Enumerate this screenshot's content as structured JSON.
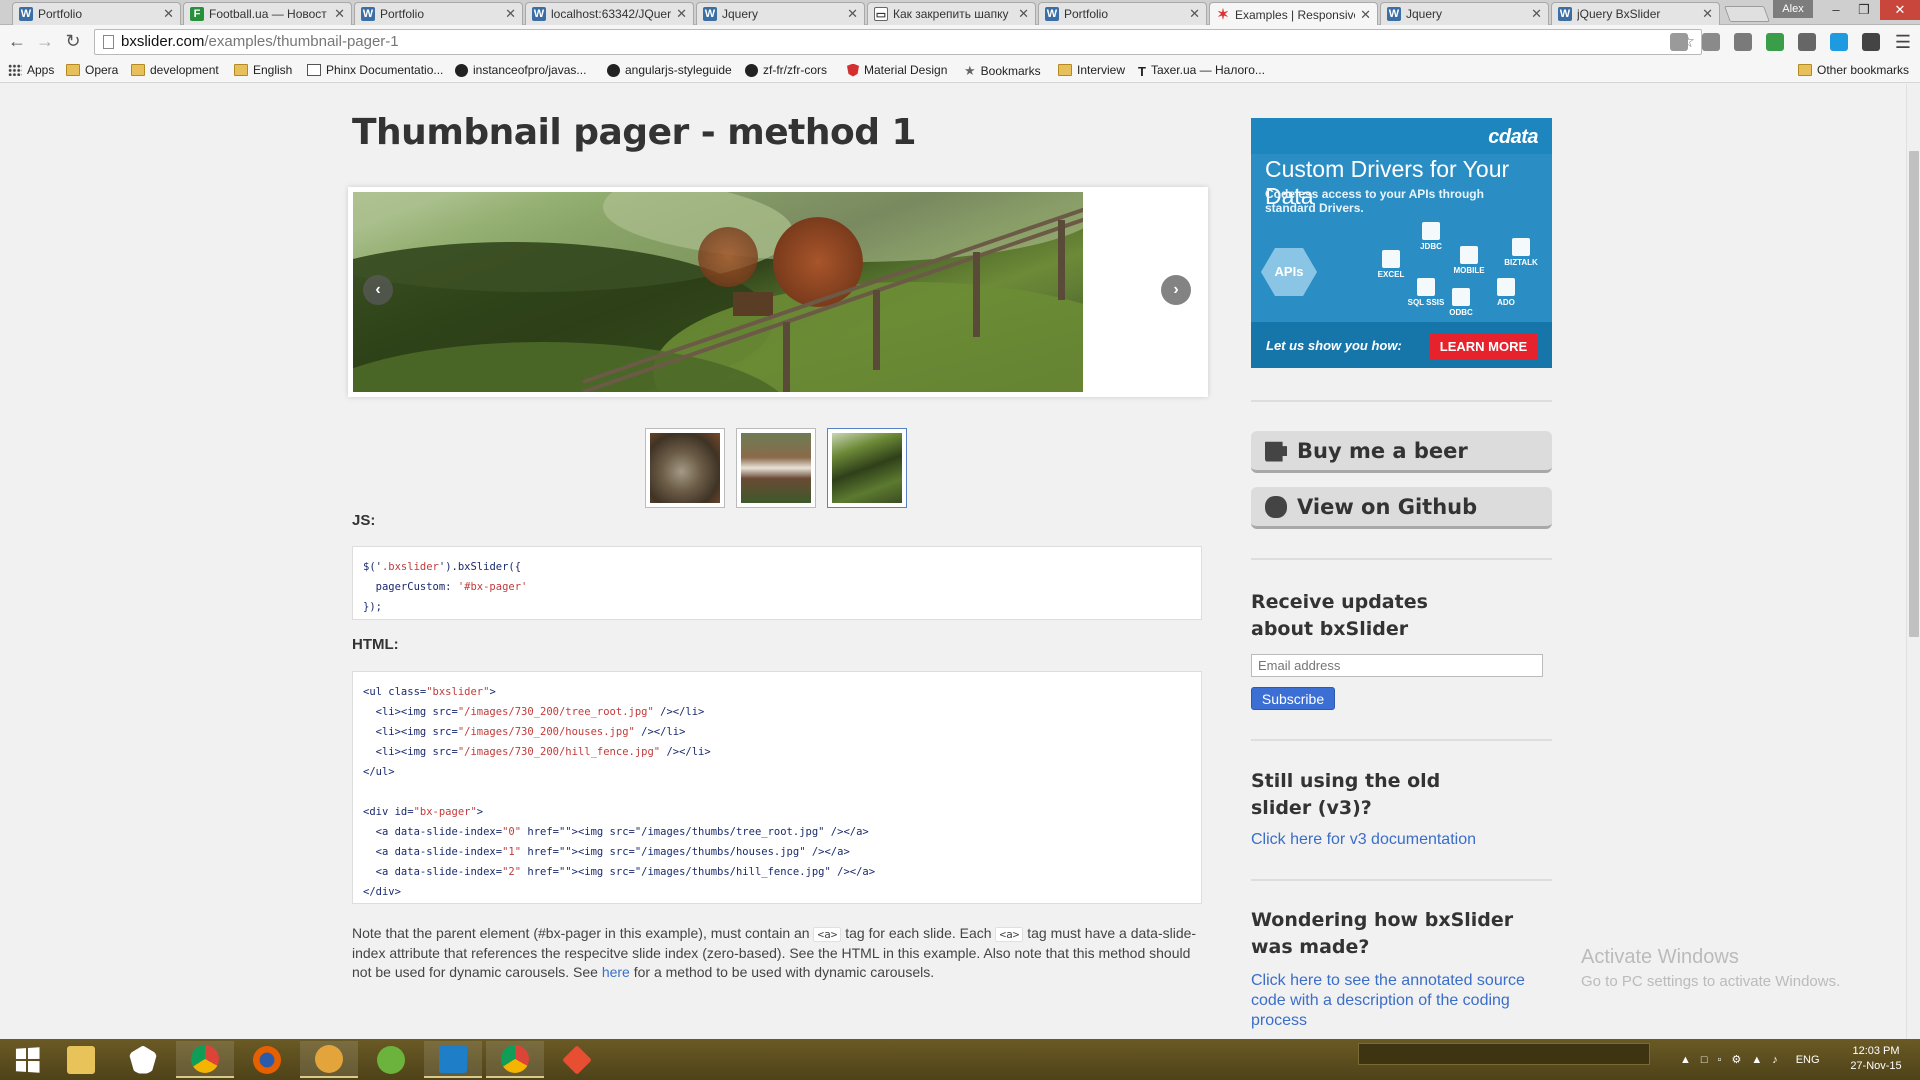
{
  "browser": {
    "tabs": [
      {
        "title": "Portfolio",
        "icon": "w-icon"
      },
      {
        "title": "Football.ua — Новост",
        "icon": "f-icon"
      },
      {
        "title": "Portfolio",
        "icon": "w-icon"
      },
      {
        "title": "localhost:63342/JQuer",
        "icon": "w-icon"
      },
      {
        "title": "Jquery",
        "icon": "w-icon"
      },
      {
        "title": "Как закрепить шапку",
        "icon": "doc-icon"
      },
      {
        "title": "Portfolio",
        "icon": "w-icon"
      },
      {
        "title": "Examples | Responsive",
        "icon": "star-icon",
        "active": true
      },
      {
        "title": "Jquery",
        "icon": "w-icon"
      },
      {
        "title": "jQuery BxSlider",
        "icon": "w-icon"
      }
    ],
    "user": "Alex",
    "address": {
      "host": "bxslider.com",
      "path": "/examples/thumbnail-pager-1"
    },
    "bookmarks": [
      {
        "label": "Apps",
        "icon": "apps-icon"
      },
      {
        "label": "Opera",
        "icon": "folder-icon"
      },
      {
        "label": "development",
        "icon": "folder-icon"
      },
      {
        "label": "English",
        "icon": "folder-icon"
      },
      {
        "label": "Phinx Documentatio...",
        "icon": "doc-icon"
      },
      {
        "label": "instanceofpro/javas...",
        "icon": "github-icon"
      },
      {
        "label": "angularjs-styleguide",
        "icon": "github-icon"
      },
      {
        "label": "zf-fr/zfr-cors",
        "icon": "github-icon"
      },
      {
        "label": "Material Design",
        "icon": "angular-icon"
      },
      {
        "label": "Bookmarks",
        "icon": "star-icon"
      },
      {
        "label": "Interview",
        "icon": "folder-icon"
      },
      {
        "label": "Taxer.ua — Налого...",
        "icon": "taxer-icon"
      }
    ],
    "other_bookmarks": "Other bookmarks"
  },
  "page": {
    "title": "Thumbnail pager - method 1",
    "js_label": "JS:",
    "html_label": "HTML:",
    "js_code": [
      [
        "$('",
        ".bxslider",
        "').bxSlider({"
      ],
      [
        "  pagerCustom: ",
        "'#bx-pager'",
        ""
      ],
      [
        "});",
        "",
        ""
      ]
    ],
    "html_code": [
      [
        "<ul class=",
        "\"bxslider\"",
        ">"
      ],
      [
        "  <li><img src=",
        "\"/images/730_200/tree_root.jpg\"",
        " /></li>"
      ],
      [
        "  <li><img src=",
        "\"/images/730_200/houses.jpg\"",
        " /></li>"
      ],
      [
        "  <li><img src=",
        "\"/images/730_200/hill_fence.jpg\"",
        " /></li>"
      ],
      [
        "</ul>",
        "",
        ""
      ],
      [
        "",
        "",
        ""
      ],
      [
        "<div id=",
        "\"bx-pager\"",
        ">"
      ],
      [
        "  <a data-slide-index=",
        "\"0\"",
        " href=\"\"><img src=\"/images/thumbs/tree_root.jpg\" /></a>"
      ],
      [
        "  <a data-slide-index=",
        "\"1\"",
        " href=\"\"><img src=\"/images/thumbs/houses.jpg\" /></a>"
      ],
      [
        "  <a data-slide-index=",
        "\"2\"",
        " href=\"\"><img src=\"/images/thumbs/hill_fence.jpg\" /></a>"
      ],
      [
        "</div>",
        "",
        ""
      ]
    ],
    "note": {
      "p1": "Note that the parent element (#bx-pager in this example), must contain an ",
      "code1": "<a>",
      "p2": " tag for each slide. Each ",
      "code2": "<a>",
      "p3": " tag must have a data-slide-index attribute that references the respecitve slide index (zero-based). See the HTML in this example. Also note that this method should not be used for dynamic carousels. See ",
      "link": "here",
      "p4": " for a method to be used with dynamic carousels."
    },
    "pager_active_index": 2
  },
  "sidebar": {
    "ad": {
      "logo": "cdata",
      "title": "Custom Drivers for Your Data",
      "subtitle": "Codeless access to your APIs through standard Drivers.",
      "apis": "APIs",
      "items": [
        "EXCEL",
        "JDBC",
        "MOBILE",
        "BIZTALK",
        "SQL SSIS",
        "ODBC",
        "ADO"
      ],
      "cta": "Let us show you how:",
      "button": "LEARN MORE"
    },
    "beer_button": "Buy me a beer",
    "github_button": "View on Github",
    "updates_heading": "Receive updates about bxSlider",
    "email_placeholder": "Email address",
    "subscribe": "Subscribe",
    "old_heading": "Still using the old slider (v3)?",
    "old_link": "Click here for v3 documentation",
    "made_heading": "Wondering how bxSlider was made?",
    "made_link": "Click here to see the annotated source code with a description of the coding process"
  },
  "os": {
    "watermark_title": "Activate Windows",
    "watermark_sub": "Go to PC settings to activate Windows.",
    "lang": "ENG",
    "time": "12:03 PM",
    "date": "27-Nov-15"
  }
}
